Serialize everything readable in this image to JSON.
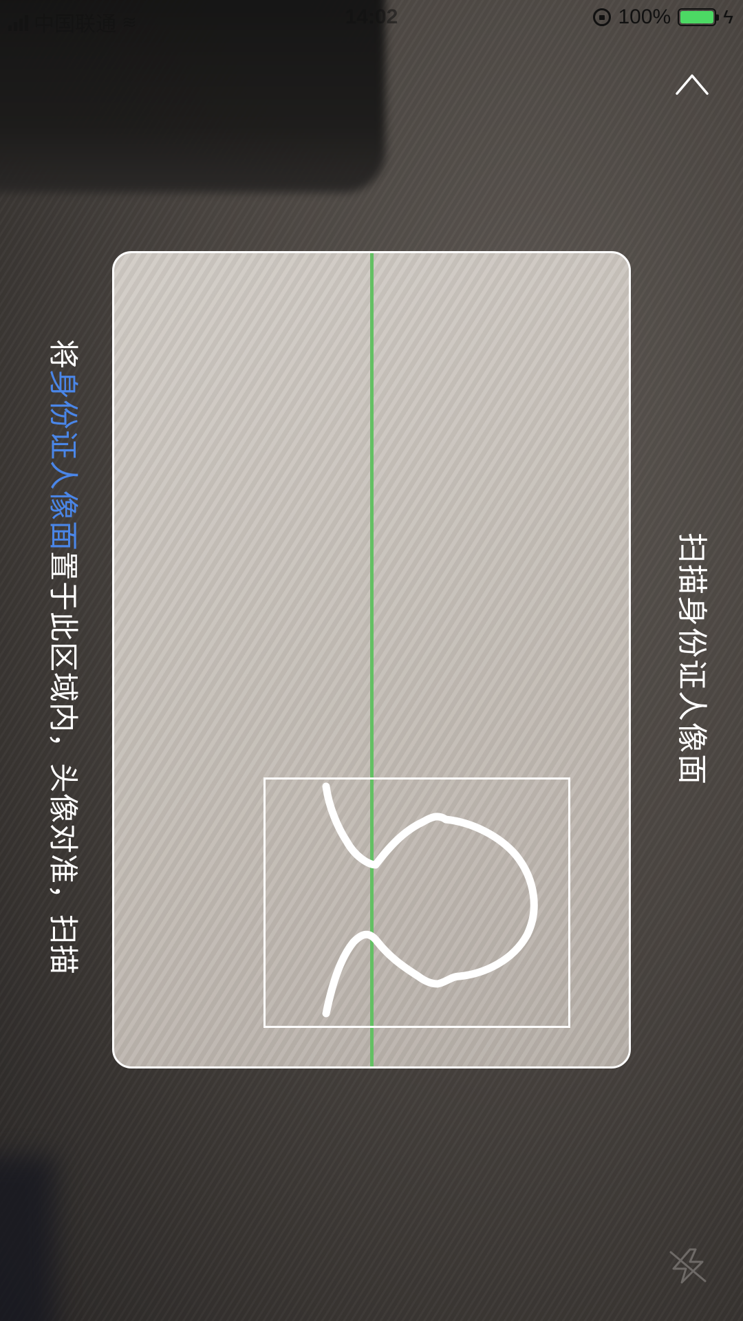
{
  "status_bar": {
    "carrier": "中国联通",
    "time": "14:02",
    "battery_percent": "100%",
    "battery_level": 1.0
  },
  "guide": {
    "prefix": "将",
    "highlight": "身份证人像面",
    "suffix": "置于此区域内，头像对准，扫描"
  },
  "title": "扫描身份证人像面",
  "icons": {
    "collapse": "chevron-up-icon",
    "flash": "flash-off-icon",
    "portrait": "head-silhouette-icon"
  },
  "colors": {
    "highlight": "#4a86e8",
    "scan_line": "#63c063",
    "battery": "#4cd964"
  }
}
